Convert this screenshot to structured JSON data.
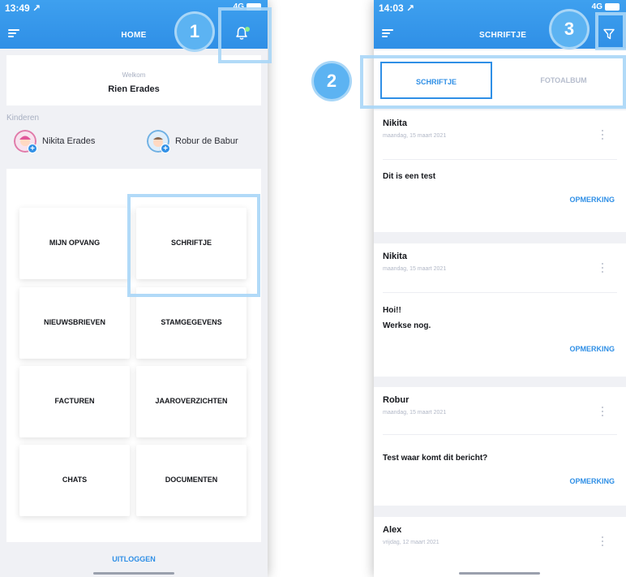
{
  "home": {
    "status": {
      "time": "13:49 ↗",
      "network": "4G"
    },
    "title": "HOME",
    "welcome_label": "Welkom",
    "user_name": "Rien Erades",
    "children_label": "Kinderen",
    "children": [
      {
        "name": "Nikita Erades"
      },
      {
        "name": "Robur de Babur"
      }
    ],
    "tiles": [
      {
        "label": "MIJN OPVANG"
      },
      {
        "label": "SCHRIFTJE"
      },
      {
        "label": "NIEUWSBRIEVEN"
      },
      {
        "label": "STAMGEGEVENS"
      },
      {
        "label": "FACTUREN"
      },
      {
        "label": "JAAROVERZICHTEN"
      },
      {
        "label": "CHATS"
      },
      {
        "label": "DOCUMENTEN"
      }
    ],
    "logout_label": "UITLOGGEN"
  },
  "schriftje": {
    "status": {
      "time": "14:03 ↗",
      "network": "4G"
    },
    "title": "SCHRIFTJE",
    "tabs": [
      {
        "label": "SCHRIFTJE",
        "active": true
      },
      {
        "label": "FOTOALBUM",
        "active": false
      }
    ],
    "posts": [
      {
        "author": "Nikita",
        "date": "maandag, 15 maart 2021",
        "lines": [
          "Dit is een test"
        ],
        "action": "OPMERKING"
      },
      {
        "author": "Nikita",
        "date": "maandag, 15 maart 2021",
        "lines": [
          "Hoi!!",
          "Werkse nog."
        ],
        "action": "OPMERKING"
      },
      {
        "author": "Robur",
        "date": "maandag, 15 maart 2021",
        "lines": [
          "Test waar komt dit bericht?"
        ],
        "action": "OPMERKING"
      },
      {
        "author": "Alex",
        "date": "vrijdag, 12 maart 2021",
        "lines": [],
        "action": ""
      }
    ]
  },
  "callouts": [
    {
      "number": "1"
    },
    {
      "number": "2"
    },
    {
      "number": "3"
    }
  ],
  "colors": {
    "accent": "#2f8fe6",
    "callout": "#a8d6f7",
    "badge": "#5cb3f2",
    "notification_dot": "#8ff08c"
  }
}
